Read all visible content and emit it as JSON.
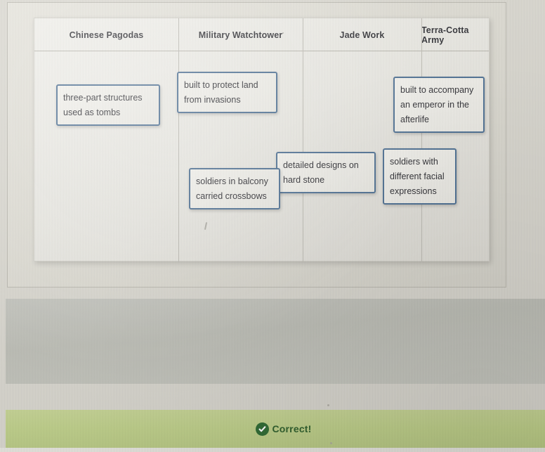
{
  "activity": {
    "type": "drag-and-drop categorization table",
    "columns": [
      {
        "id": "chinese-pagodas",
        "label": "Chinese Pagodas"
      },
      {
        "id": "military-watchtower",
        "label": "Military Watchtower"
      },
      {
        "id": "jade-work",
        "label": "Jade Work"
      },
      {
        "id": "terra-cotta-army",
        "label": "Terra-Cotta Army"
      }
    ],
    "tiles": [
      {
        "id": "tile-pagodas",
        "column": "chinese-pagodas",
        "lines": [
          "three-part structures",
          "used as tombs"
        ]
      },
      {
        "id": "tile-watchtower-protect",
        "column": "military-watchtower",
        "lines": [
          "built to protect land",
          "from invasions"
        ]
      },
      {
        "id": "tile-watchtower-balcony",
        "column": "military-watchtower",
        "lines": [
          "soldiers in balcony",
          "carried crossbows"
        ]
      },
      {
        "id": "tile-jade-designs",
        "column": "jade-work",
        "lines": [
          "detailed designs on",
          "hard stone"
        ]
      },
      {
        "id": "tile-terracotta-emperor",
        "column": "terra-cotta-army",
        "lines": [
          "built to accompany",
          "an emperor in the",
          "afterlife"
        ]
      },
      {
        "id": "tile-terracotta-faces",
        "column": "terra-cotta-army",
        "lines": [
          "soldiers with",
          "different facial",
          "expressions"
        ]
      }
    ]
  },
  "feedback": {
    "message": "Correct!",
    "icon": "check-circle-icon",
    "banner_color": "#bfd08a",
    "icon_color": "#2f6b33",
    "text_color": "#2f5f2c"
  },
  "theme": {
    "tile_border": "#4a6d91",
    "table_background": "#eceae4",
    "page_background": "#d8d6ce",
    "panel_gray": "#c3c4bd"
  }
}
